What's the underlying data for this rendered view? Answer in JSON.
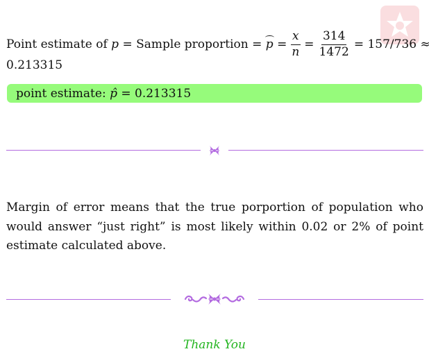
{
  "estimate_line": {
    "part1": "Point estimate of",
    "var_p": "p",
    "eq": "=",
    "part2": "Sample proportion",
    "phat": "p",
    "x": "x",
    "n": "n",
    "num": "314",
    "den": "1472",
    "result": "= 157/736 ≈",
    "decimal": "0.213315"
  },
  "highlight": {
    "label": "point estimate:",
    "phat": "p̂",
    "value": "= 0.213315",
    "color": "#96fb7b"
  },
  "paragraph": "Margin of error means that the true porportion of population who would answer “just right” is most likely within 0.02 or 2% of point estimate calculated above.",
  "closing": {
    "text": "Thank You",
    "color": "#22b41f"
  },
  "ornament_color": "#b36be0",
  "watermark_color": "#e8505b"
}
